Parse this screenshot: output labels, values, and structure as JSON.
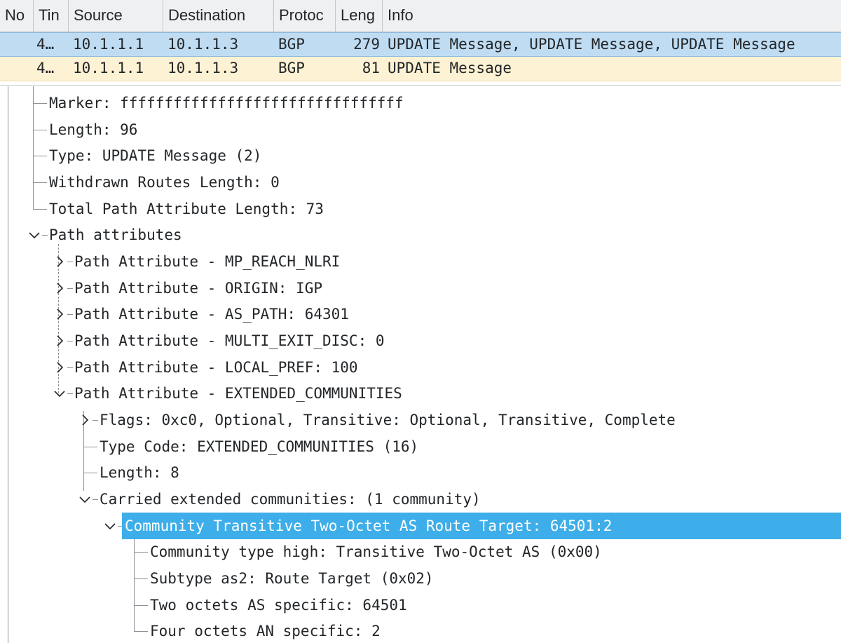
{
  "packet_list": {
    "columns": [
      "No",
      "Tin",
      "Source",
      "Destination",
      "Protoc",
      "Leng",
      "Info"
    ],
    "rows": [
      {
        "no": "4…",
        "source": "10.1.1.1",
        "destination": "10.1.1.3",
        "protocol": "BGP",
        "length": "279",
        "info": "UPDATE Message, UPDATE Message, UPDATE Message",
        "selected": true
      },
      {
        "no": "4…",
        "source": "10.1.1.1",
        "destination": "10.1.1.3",
        "protocol": "BGP",
        "length": "81",
        "info": "UPDATE Message",
        "selected": false
      }
    ]
  },
  "details": {
    "items": [
      {
        "text": "Marker: ffffffffffffffffffffffffffffffff"
      },
      {
        "text": "Length: 96"
      },
      {
        "text": "Type: UPDATE Message (2)"
      },
      {
        "text": "Withdrawn Routes Length: 0"
      },
      {
        "text": "Total Path Attribute Length: 73"
      },
      {
        "text": "Path attributes",
        "state": "expanded"
      },
      {
        "text": "Path Attribute - MP_REACH_NLRI",
        "state": "collapsed"
      },
      {
        "text": "Path Attribute - ORIGIN: IGP",
        "state": "collapsed"
      },
      {
        "text": "Path Attribute - AS_PATH: 64301",
        "state": "collapsed"
      },
      {
        "text": "Path Attribute - MULTI_EXIT_DISC: 0",
        "state": "collapsed"
      },
      {
        "text": "Path Attribute - LOCAL_PREF: 100",
        "state": "collapsed"
      },
      {
        "text": "Path Attribute - EXTENDED_COMMUNITIES",
        "state": "expanded"
      },
      {
        "text": "Flags: 0xc0, Optional, Transitive: Optional, Transitive, Complete",
        "state": "collapsed"
      },
      {
        "text": "Type Code: EXTENDED_COMMUNITIES (16)"
      },
      {
        "text": "Length: 8"
      },
      {
        "text": "Carried extended communities: (1 community)",
        "state": "expanded"
      },
      {
        "text": "Community Transitive Two-Octet AS Route Target: 64501:2",
        "state": "expanded",
        "selected": true
      },
      {
        "text": "Community type high: Transitive Two-Octet AS (0x00)"
      },
      {
        "text": "Subtype as2: Route Target (0x02)"
      },
      {
        "text": "Two octets AS specific: 64501"
      },
      {
        "text": "Four octets AN specific: 2"
      }
    ]
  },
  "colors": {
    "selected_row": "#bfdcf2",
    "marked_row": "#fdf2d3",
    "tree_selection": "#3daee9",
    "header_bg": "#eff0f1"
  },
  "icons": {
    "expanded": "chevron-down-icon",
    "collapsed": "chevron-right-icon"
  }
}
